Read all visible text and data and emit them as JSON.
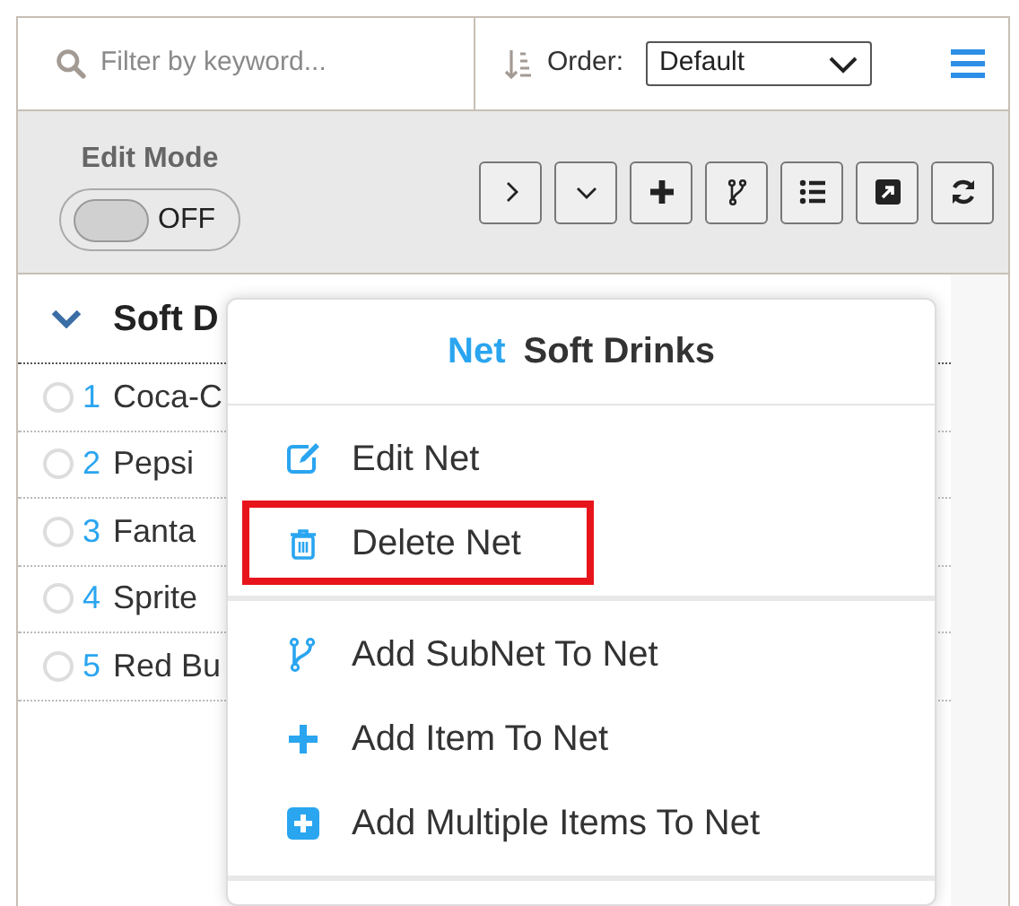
{
  "search": {
    "placeholder": "Filter by keyword..."
  },
  "order": {
    "label": "Order:",
    "value": "Default"
  },
  "edit_mode": {
    "label": "Edit Mode",
    "on": false,
    "state_text": "OFF"
  },
  "group": {
    "title": "Soft D",
    "expanded": true
  },
  "items": [
    {
      "number": "1",
      "name": "Coca-C",
      "selected": false
    },
    {
      "number": "2",
      "name": "Pepsi",
      "selected": false
    },
    {
      "number": "3",
      "name": "Fanta",
      "selected": false
    },
    {
      "number": "4",
      "name": "Sprite",
      "selected": false
    },
    {
      "number": "5",
      "name": "Red Bu",
      "selected": false
    }
  ],
  "context_menu": {
    "title_prefix": "Net",
    "title": "Soft Drinks",
    "sections": [
      [
        {
          "label": "Edit Net",
          "highlighted": false
        },
        {
          "label": "Delete Net",
          "highlighted": true
        }
      ],
      [
        {
          "label": "Add SubNet To Net",
          "highlighted": false
        },
        {
          "label": "Add Item To Net",
          "highlighted": false
        },
        {
          "label": "Add Multiple Items To Net",
          "highlighted": false
        }
      ]
    ]
  }
}
